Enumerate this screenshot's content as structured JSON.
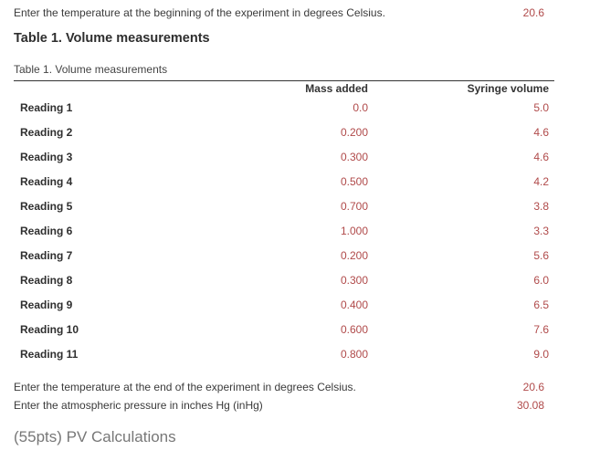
{
  "start_temperature": {
    "label": "Enter the temperature at the beginning of the experiment in degrees Celsius.",
    "value": "20.6"
  },
  "section_heading": "Table 1. Volume measurements",
  "table": {
    "caption": "Table 1. Volume measurements",
    "headers": [
      "",
      "Mass added",
      "Syringe volume"
    ],
    "rows": [
      {
        "label": "Reading 1",
        "mass": "0.0",
        "volume": "5.0"
      },
      {
        "label": "Reading 2",
        "mass": "0.200",
        "volume": "4.6"
      },
      {
        "label": "Reading 3",
        "mass": "0.300",
        "volume": "4.6"
      },
      {
        "label": "Reading 4",
        "mass": "0.500",
        "volume": "4.2"
      },
      {
        "label": "Reading 5",
        "mass": "0.700",
        "volume": "3.8"
      },
      {
        "label": "Reading 6",
        "mass": "1.000",
        "volume": "3.3"
      },
      {
        "label": "Reading 7",
        "mass": "0.200",
        "volume": "5.6"
      },
      {
        "label": "Reading 8",
        "mass": "0.300",
        "volume": "6.0"
      },
      {
        "label": "Reading 9",
        "mass": "0.400",
        "volume": "6.5"
      },
      {
        "label": "Reading 10",
        "mass": "0.600",
        "volume": "7.6"
      },
      {
        "label": "Reading 11",
        "mass": "0.800",
        "volume": "9.0"
      }
    ]
  },
  "end_temperature": {
    "label": "Enter the temperature at the end of the experiment in degrees Celsius.",
    "value": "20.6"
  },
  "atmospheric_pressure": {
    "label": "Enter the atmospheric pressure in inches Hg (inHg)",
    "value": "30.08"
  },
  "pv_heading": "(55pts) PV Calculations",
  "colors": {
    "answer_value": "#b04a4a",
    "text": "#333333",
    "muted_heading": "#777777"
  }
}
